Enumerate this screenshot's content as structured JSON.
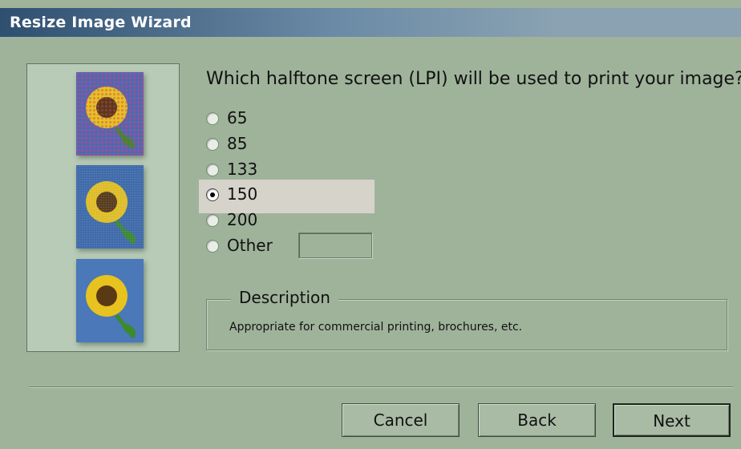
{
  "window": {
    "title": "Resize Image Wizard"
  },
  "question": "Which halftone screen (LPI) will be used to print your image?",
  "options": [
    {
      "label": "65",
      "checked": false
    },
    {
      "label": "85",
      "checked": false
    },
    {
      "label": "133",
      "checked": false
    },
    {
      "label": "150",
      "checked": true
    },
    {
      "label": "200",
      "checked": false
    },
    {
      "label": "Other",
      "checked": false
    }
  ],
  "other_value": "",
  "description": {
    "legend": "Description",
    "text": "Appropriate for commercial printing, brochures, etc."
  },
  "buttons": {
    "cancel": "Cancel",
    "back": "Back",
    "next": "Next"
  },
  "colors": {
    "background": "#9fb39b",
    "titlebar": "#2f4f70",
    "selected_option": "#d6d3ca"
  }
}
